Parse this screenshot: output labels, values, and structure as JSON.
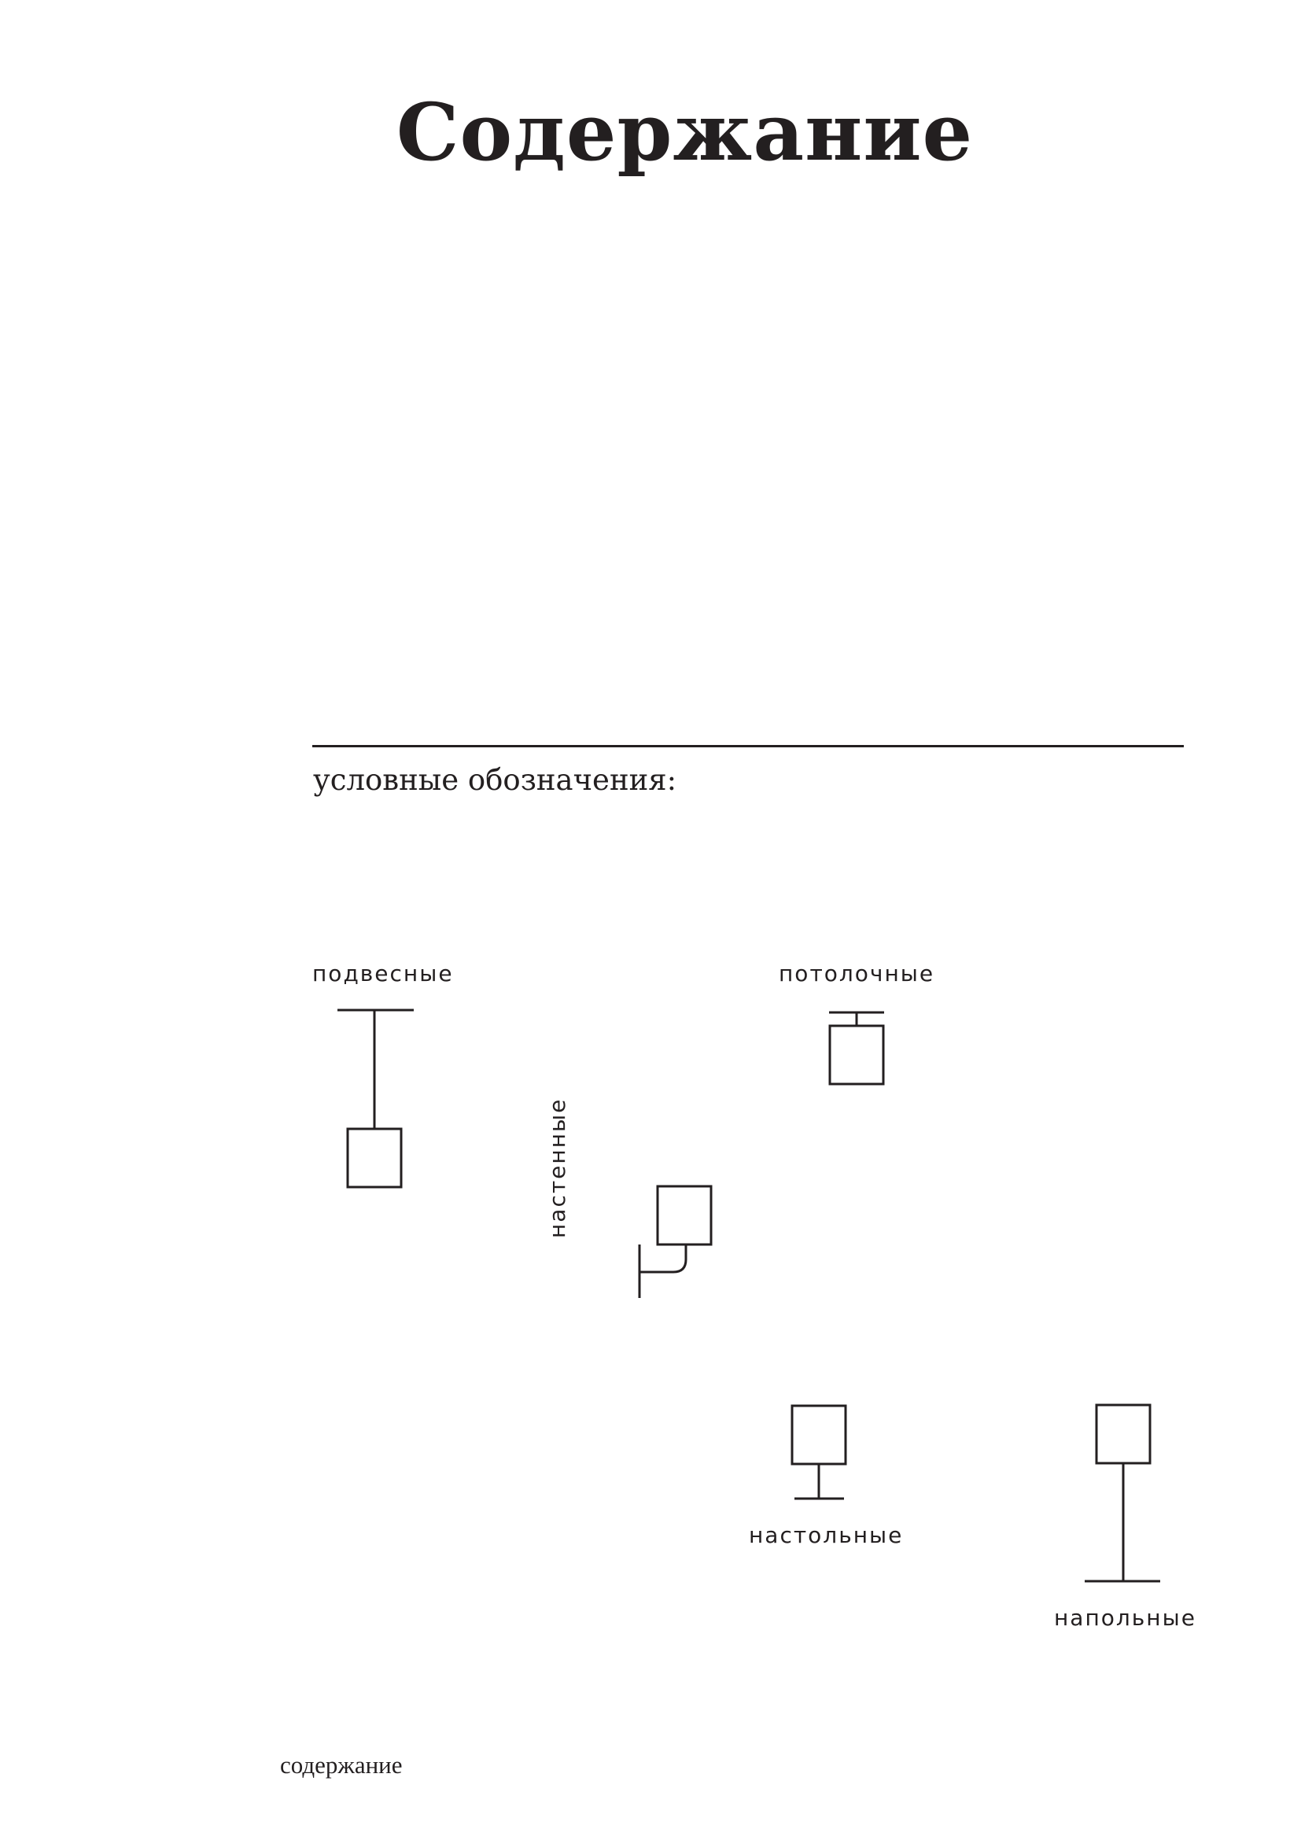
{
  "page": {
    "title": "Содержание",
    "footer": "содержание"
  },
  "legend": {
    "heading": "условные обозначения:",
    "items": [
      {
        "key": "pendant",
        "label": "подвесные",
        "icon": "pendant-lamp-icon"
      },
      {
        "key": "ceiling",
        "label": "потолочные",
        "icon": "ceiling-lamp-icon"
      },
      {
        "key": "wall",
        "label": "настенные",
        "icon": "wall-lamp-icon"
      },
      {
        "key": "table",
        "label": "настольные",
        "icon": "table-lamp-icon"
      },
      {
        "key": "floor",
        "label": "напольные",
        "icon": "floor-lamp-icon"
      }
    ]
  },
  "colors": {
    "ink": "#231f20",
    "background": "#ffffff"
  }
}
